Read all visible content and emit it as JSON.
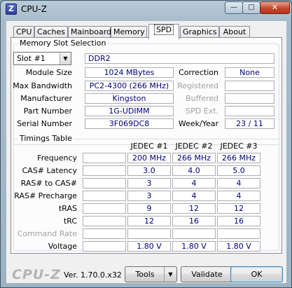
{
  "window": {
    "title": "CPU-Z",
    "icon_letter": "Z",
    "min": "—",
    "max": "□",
    "close": "✕"
  },
  "tabs": [
    "CPU",
    "Caches",
    "Mainboard",
    "Memory",
    "SPD",
    "Graphics",
    "About"
  ],
  "active_tab": "SPD",
  "memory_slot": {
    "legend": "Memory Slot Selection",
    "slot_selected": "Slot #1",
    "dropdown_arrow": "▼",
    "memory_type": "DDR2",
    "labels": {
      "module_size": "Module Size",
      "max_bandwidth": "Max Bandwidth",
      "manufacturer": "Manufacturer",
      "part_number": "Part Number",
      "serial_number": "Serial Number",
      "correction": "Correction",
      "registered": "Registered",
      "buffered": "Buffered",
      "spd_ext": "SPD Ext.",
      "week_year": "Week/Year"
    },
    "values": {
      "module_size": "1024 MBytes",
      "max_bandwidth": "PC2-4300 (266 MHz)",
      "manufacturer": "Kingston",
      "part_number": "1G-UDIMM",
      "serial_number": "3F069DC8",
      "correction": "None",
      "registered": "",
      "buffered": "",
      "spd_ext": "",
      "week_year": "23 / 11"
    }
  },
  "timings": {
    "legend": "Timings Table",
    "columns": [
      "JEDEC #1",
      "JEDEC #2",
      "JEDEC #3"
    ],
    "rows": [
      {
        "label": "Frequency",
        "cells": [
          "200 MHz",
          "266 MHz",
          "266 MHz"
        ]
      },
      {
        "label": "CAS# Latency",
        "cells": [
          "3.0",
          "4.0",
          "5.0"
        ]
      },
      {
        "label": "RAS# to CAS#",
        "cells": [
          "3",
          "4",
          "4"
        ]
      },
      {
        "label": "RAS# Precharge",
        "cells": [
          "3",
          "4",
          "4"
        ]
      },
      {
        "label": "tRAS",
        "cells": [
          "9",
          "12",
          "12"
        ]
      },
      {
        "label": "tRC",
        "cells": [
          "12",
          "16",
          "16"
        ]
      },
      {
        "label": "Command Rate",
        "cells": [
          "",
          "",
          ""
        ]
      },
      {
        "label": "Voltage",
        "cells": [
          "1.80 V",
          "1.80 V",
          "1.80 V"
        ]
      }
    ]
  },
  "footer": {
    "brand": "CPU-Z",
    "version": "Ver. 1.70.0.x32",
    "tools_label": "Tools",
    "tools_arrow": "▼",
    "validate_label": "Validate",
    "ok_label": "OK"
  }
}
